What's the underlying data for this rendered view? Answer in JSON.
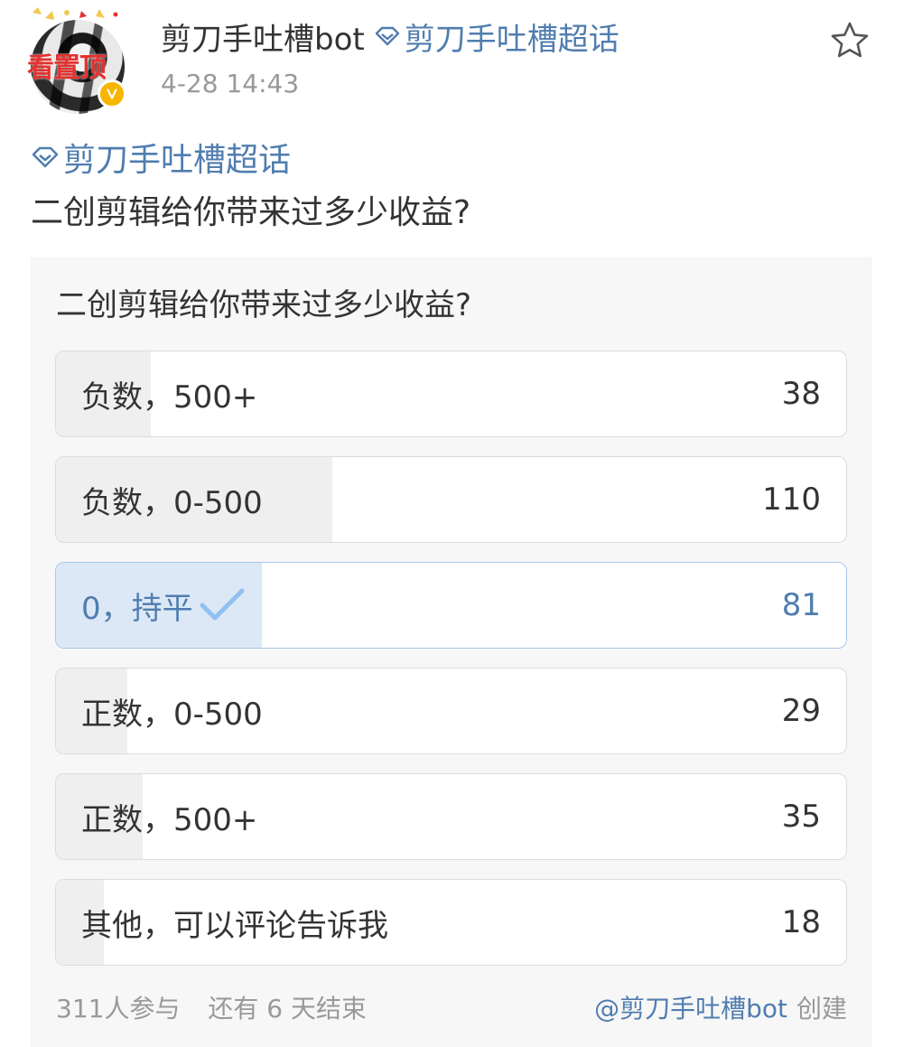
{
  "header": {
    "avatar_sticker_text": "看置顶",
    "username": "剪刀手吐槽bot",
    "supertopic_tag": "剪刀手吐槽超话",
    "timestamp": "4-28 14:43"
  },
  "post": {
    "topic_link": "剪刀手吐槽超话",
    "text": "二创剪辑给你带来过多少收益?"
  },
  "poll": {
    "question": "二创剪辑给你带来过多少收益?",
    "options": [
      {
        "label": "负数，500+",
        "count": "38",
        "share": 0.12,
        "voted": false
      },
      {
        "label": "负数，0-500",
        "count": "110",
        "share": 0.35,
        "voted": false
      },
      {
        "label": "0，持平",
        "count": "81",
        "share": 0.26,
        "voted": true
      },
      {
        "label": "正数，0-500",
        "count": "29",
        "share": 0.09,
        "voted": false
      },
      {
        "label": "正数，500+",
        "count": "35",
        "share": 0.11,
        "voted": false
      },
      {
        "label": "其他，可以评论告诉我",
        "count": "18",
        "share": 0.06,
        "voted": false
      }
    ],
    "participants": "311人参与",
    "remaining": "还有 6 天结束",
    "creator": "@剪刀手吐槽bot",
    "creator_suffix": "创建"
  },
  "icons": {
    "supertopic": "diamond-icon",
    "favorite": "star-outline-icon",
    "verified": "verified-badge-icon",
    "voted": "check-icon"
  },
  "colors": {
    "link": "#507daf",
    "muted": "#999999",
    "voted_fill": "#dce8f6",
    "voted_border": "#a9c8ec",
    "result_fill": "#efefef",
    "verified": "#f7b500",
    "card_bg": "#f7f7f7"
  }
}
